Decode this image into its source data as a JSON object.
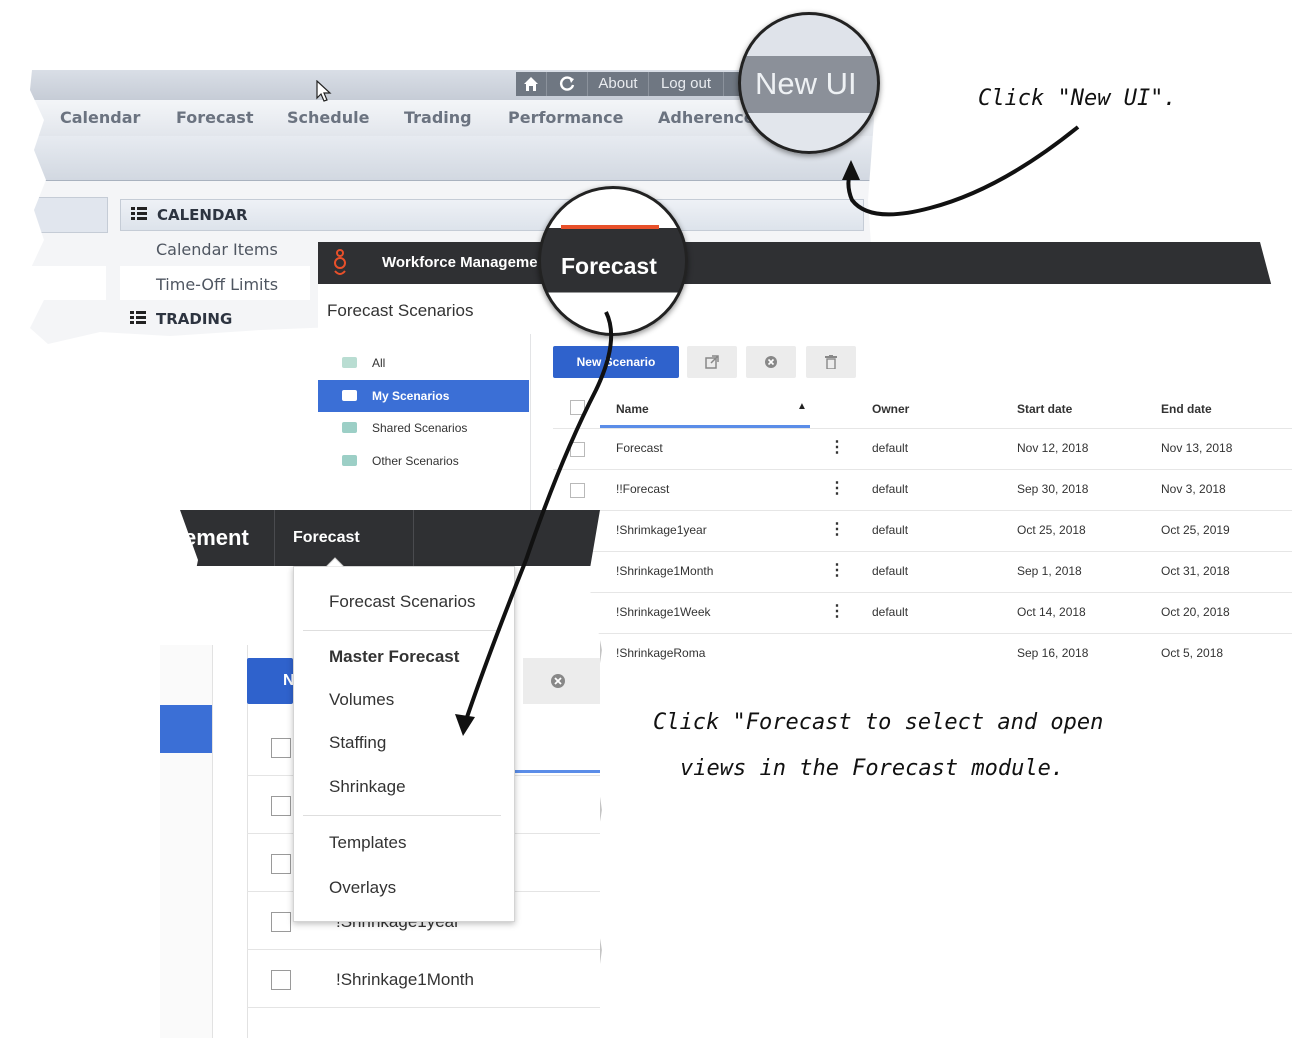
{
  "old_ui": {
    "top_buttons": [
      "About",
      "Log out"
    ],
    "new_ui_label": "New UI",
    "nav": [
      "Calendar",
      "Forecast",
      "Schedule",
      "Trading",
      "Performance",
      "Adherence"
    ],
    "sections": [
      {
        "title": "CALENDAR",
        "items": [
          "Calendar Items",
          "Time-Off Limits"
        ]
      },
      {
        "title": "TRADING",
        "items": []
      }
    ]
  },
  "new_ui": {
    "app_title": "Workforce Management",
    "active_tab": "Forecast",
    "page_title": "Forecast Scenarios",
    "sidebar": [
      {
        "label": "All",
        "active": false
      },
      {
        "label": "My Scenarios",
        "active": true
      },
      {
        "label": "Shared Scenarios",
        "active": false
      },
      {
        "label": "Other Scenarios",
        "active": false
      }
    ],
    "toolbar": {
      "new_scenario": "New Scenario"
    },
    "table": {
      "headers": [
        "Name",
        "Owner",
        "Start date",
        "End date"
      ],
      "rows": [
        [
          "Forecast",
          "default",
          "Nov 12, 2018",
          "Nov 13, 2018"
        ],
        [
          "!!Forecast",
          "default",
          "Sep 30, 2018",
          "Nov 3, 2018"
        ],
        [
          "!Shrimkage1year",
          "default",
          "Oct 25, 2018",
          "Oct 25, 2019"
        ],
        [
          "!Shrinkage1Month",
          "default",
          "Sep 1, 2018",
          "Oct 31, 2018"
        ],
        [
          "!Shrinkage1Week",
          "default",
          "Oct 14, 2018",
          "Oct 20, 2018"
        ],
        [
          "!ShrinkageRoma",
          "",
          "Sep 16, 2018",
          "Oct 5, 2018"
        ]
      ]
    }
  },
  "menu_view": {
    "header_fragment": "ement",
    "tab": "Forecast",
    "button_fragment": "N",
    "dropdown": [
      "Forecast Scenarios",
      "Master Forecast",
      "Volumes",
      "Staffing",
      "Shrinkage",
      "Templates",
      "Overlays"
    ],
    "rows": [
      "!Shrinkage1year",
      "!Shrinkage1Month"
    ]
  },
  "annotations": {
    "new_ui_note": "Click \"New UI\".",
    "forecast_note_line1": "Click \"Forecast to select and open",
    "forecast_note_line2": "views in the Forecast module."
  },
  "colors": {
    "header_dark": "#2f3033",
    "accent_blue": "#2f62cc",
    "accent_orange": "#e8502a",
    "folder_teal": "#9ccfc6"
  }
}
